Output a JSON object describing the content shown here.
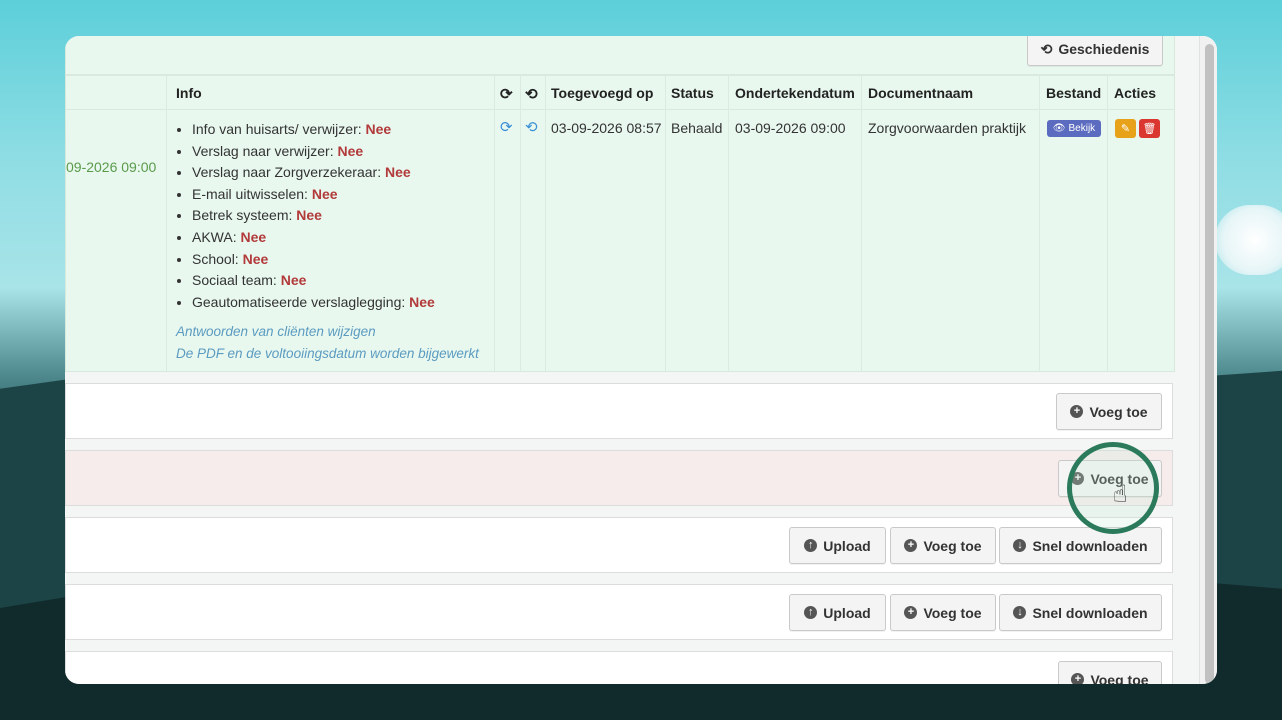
{
  "header": {
    "history_button": "Geschiedenis"
  },
  "table": {
    "columns": {
      "info": "Info",
      "added_on": "Toegevoegd op",
      "status": "Status",
      "signed_date": "Ondertekendatum",
      "document_name": "Documentnaam",
      "file": "Bestand",
      "actions": "Acties"
    },
    "row": {
      "partial_date": "09-2026 09:00",
      "added_on": "03-09-2026 08:57",
      "status": "Behaald",
      "signed_date": "03-09-2026 09:00",
      "document_name": "Zorgvoorwaarden praktijk",
      "view_badge": "Bekijk",
      "info_items": [
        {
          "label": "Info van huisarts/ verwijzer:",
          "value": "Nee"
        },
        {
          "label": "Verslag naar verwijzer:",
          "value": "Nee"
        },
        {
          "label": "Verslag naar Zorgverzekeraar:",
          "value": "Nee"
        },
        {
          "label": "E-mail uitwisselen:",
          "value": "Nee"
        },
        {
          "label": "Betrek systeem:",
          "value": "Nee"
        },
        {
          "label": "AKWA:",
          "value": "Nee"
        },
        {
          "label": "School:",
          "value": "Nee"
        },
        {
          "label": "Sociaal team:",
          "value": "Nee"
        },
        {
          "label": "Geautomatiseerde verslaglegging:",
          "value": "Nee"
        }
      ],
      "note_line1": "Antwoorden van cliënten wijzigen",
      "note_line2": "De PDF en de voltooiingsdatum worden bijgewerkt"
    }
  },
  "buttons": {
    "add": "Voeg toe",
    "upload": "Upload",
    "quick_download": "Snel downloaden"
  },
  "colors": {
    "row_bg": "#e8f8ef",
    "negative": "#b23a3a",
    "link": "#5b9bc0",
    "badge": "#5b6bbf",
    "edit": "#e8a21a",
    "delete": "#d9372f",
    "highlight_ring": "#2a7a5b"
  }
}
